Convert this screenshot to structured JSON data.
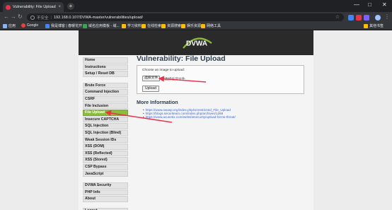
{
  "browser": {
    "tab_title": "Vulnerability: File Upload :: D",
    "tab_close": "×",
    "new_tab": "+",
    "window_controls": [
      "—",
      "□",
      "✕"
    ],
    "security_label": "不安全",
    "separator": "|",
    "url": "192.168.0.107/DVWA-master/vulnerabilities/upload/",
    "bookmarks": [
      {
        "label": "应用",
        "color": "#8ab4f8"
      },
      {
        "label": "Google",
        "color": "#ea4335"
      },
      {
        "label": "我是博客 | 春暖花开",
        "color": "#4285f4"
      },
      {
        "label": "域名应用模板 - 域...",
        "color": "#34a853"
      },
      {
        "label": "学习资料",
        "color": "#fbbc04"
      },
      {
        "label": "在线检索",
        "color": "#fbbc04"
      },
      {
        "label": "资源搜索",
        "color": "#fbbc04"
      },
      {
        "label": "娱乐资源",
        "color": "#fbbc04"
      },
      {
        "label": "网络工具",
        "color": "#fbbc04"
      },
      {
        "label": "其他书签",
        "color": "#fbbc04"
      }
    ]
  },
  "logo_text": "DVWA",
  "menu": {
    "groups": [
      [
        "Home",
        "Instructions",
        "Setup / Reset DB"
      ],
      [
        "Brute Force",
        "Command Injection",
        "CSRF",
        "File Inclusion",
        "File Upload",
        "Insecure CAPTCHA",
        "SQL Injection",
        "SQL Injection (Blind)",
        "Weak Session IDs",
        "XSS (DOM)",
        "XSS (Reflected)",
        "XSS (Stored)",
        "CSP Bypass",
        "JavaScript"
      ],
      [
        "DVWA Security",
        "PHP Info",
        "About"
      ],
      [
        "Logout"
      ]
    ],
    "selected": "File Upload"
  },
  "main": {
    "title": "Vulnerability: File Upload",
    "upload_label": "Choose an image to upload:",
    "choose_file_button": "选择文件",
    "no_file_text": "未选择任何文件",
    "upload_button": "Upload",
    "more_info_title": "More Information",
    "links": [
      "https://www.owasp.org/index.php/Unrestricted_File_Upload",
      "https://blogs.securiteam.com/index.php/archives/1268",
      "https://www.acunetix.com/websitesecurity/upload-forms-threat/"
    ]
  },
  "colors": {
    "accent_green": "#8bbc3c",
    "annotation_red": "#e8334a",
    "link_blue": "#3b6ad8",
    "heading": "#2b3d4e"
  }
}
